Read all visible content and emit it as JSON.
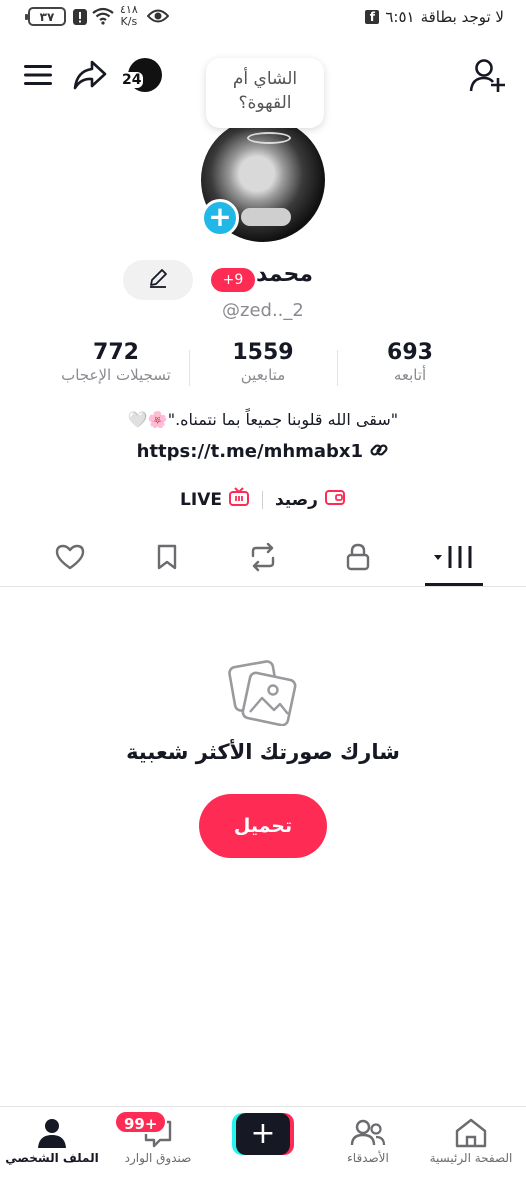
{
  "status_bar": {
    "carrier_text": "لا توجد بطاقة",
    "time": "٦:٥١",
    "network_speed_value": "٤١٨",
    "network_speed_unit": "K/s",
    "battery": "٣٧"
  },
  "header": {
    "counter_badge": "24"
  },
  "note_bubble": {
    "text": "الشاي أم القهوة؟"
  },
  "profile": {
    "name": "محمد",
    "badge": "+9",
    "username": "@zed.._2",
    "stats": [
      {
        "value": "693",
        "label": "أتابعه"
      },
      {
        "value": "1559",
        "label": "متابعين"
      },
      {
        "value": "772",
        "label": "تسجيلات الإعجاب"
      }
    ],
    "bio": "\"سقى الله قلوبنا جميعاً بما نتمناه.\"🌸🤍",
    "link": "https://t.me/mhmabx1",
    "chips": {
      "balance": "رصيد",
      "live": "LIVE"
    }
  },
  "tabs": [
    "videos",
    "private",
    "reposts",
    "favorites",
    "liked"
  ],
  "empty_state": {
    "title": "شارك صورتك الأكثر شعبية",
    "button": "تحميل"
  },
  "bottom_nav": {
    "home": "الصفحة الرئيسية",
    "friends": "الأصدقاء",
    "inbox": "صندوق الوارد",
    "inbox_badge": "99+",
    "profile": "الملف الشخصي"
  },
  "colors": {
    "accent": "#fe2c55",
    "avatar_add": "#21b8e8",
    "text_primary": "#161823",
    "text_secondary": "#8a8b91"
  }
}
